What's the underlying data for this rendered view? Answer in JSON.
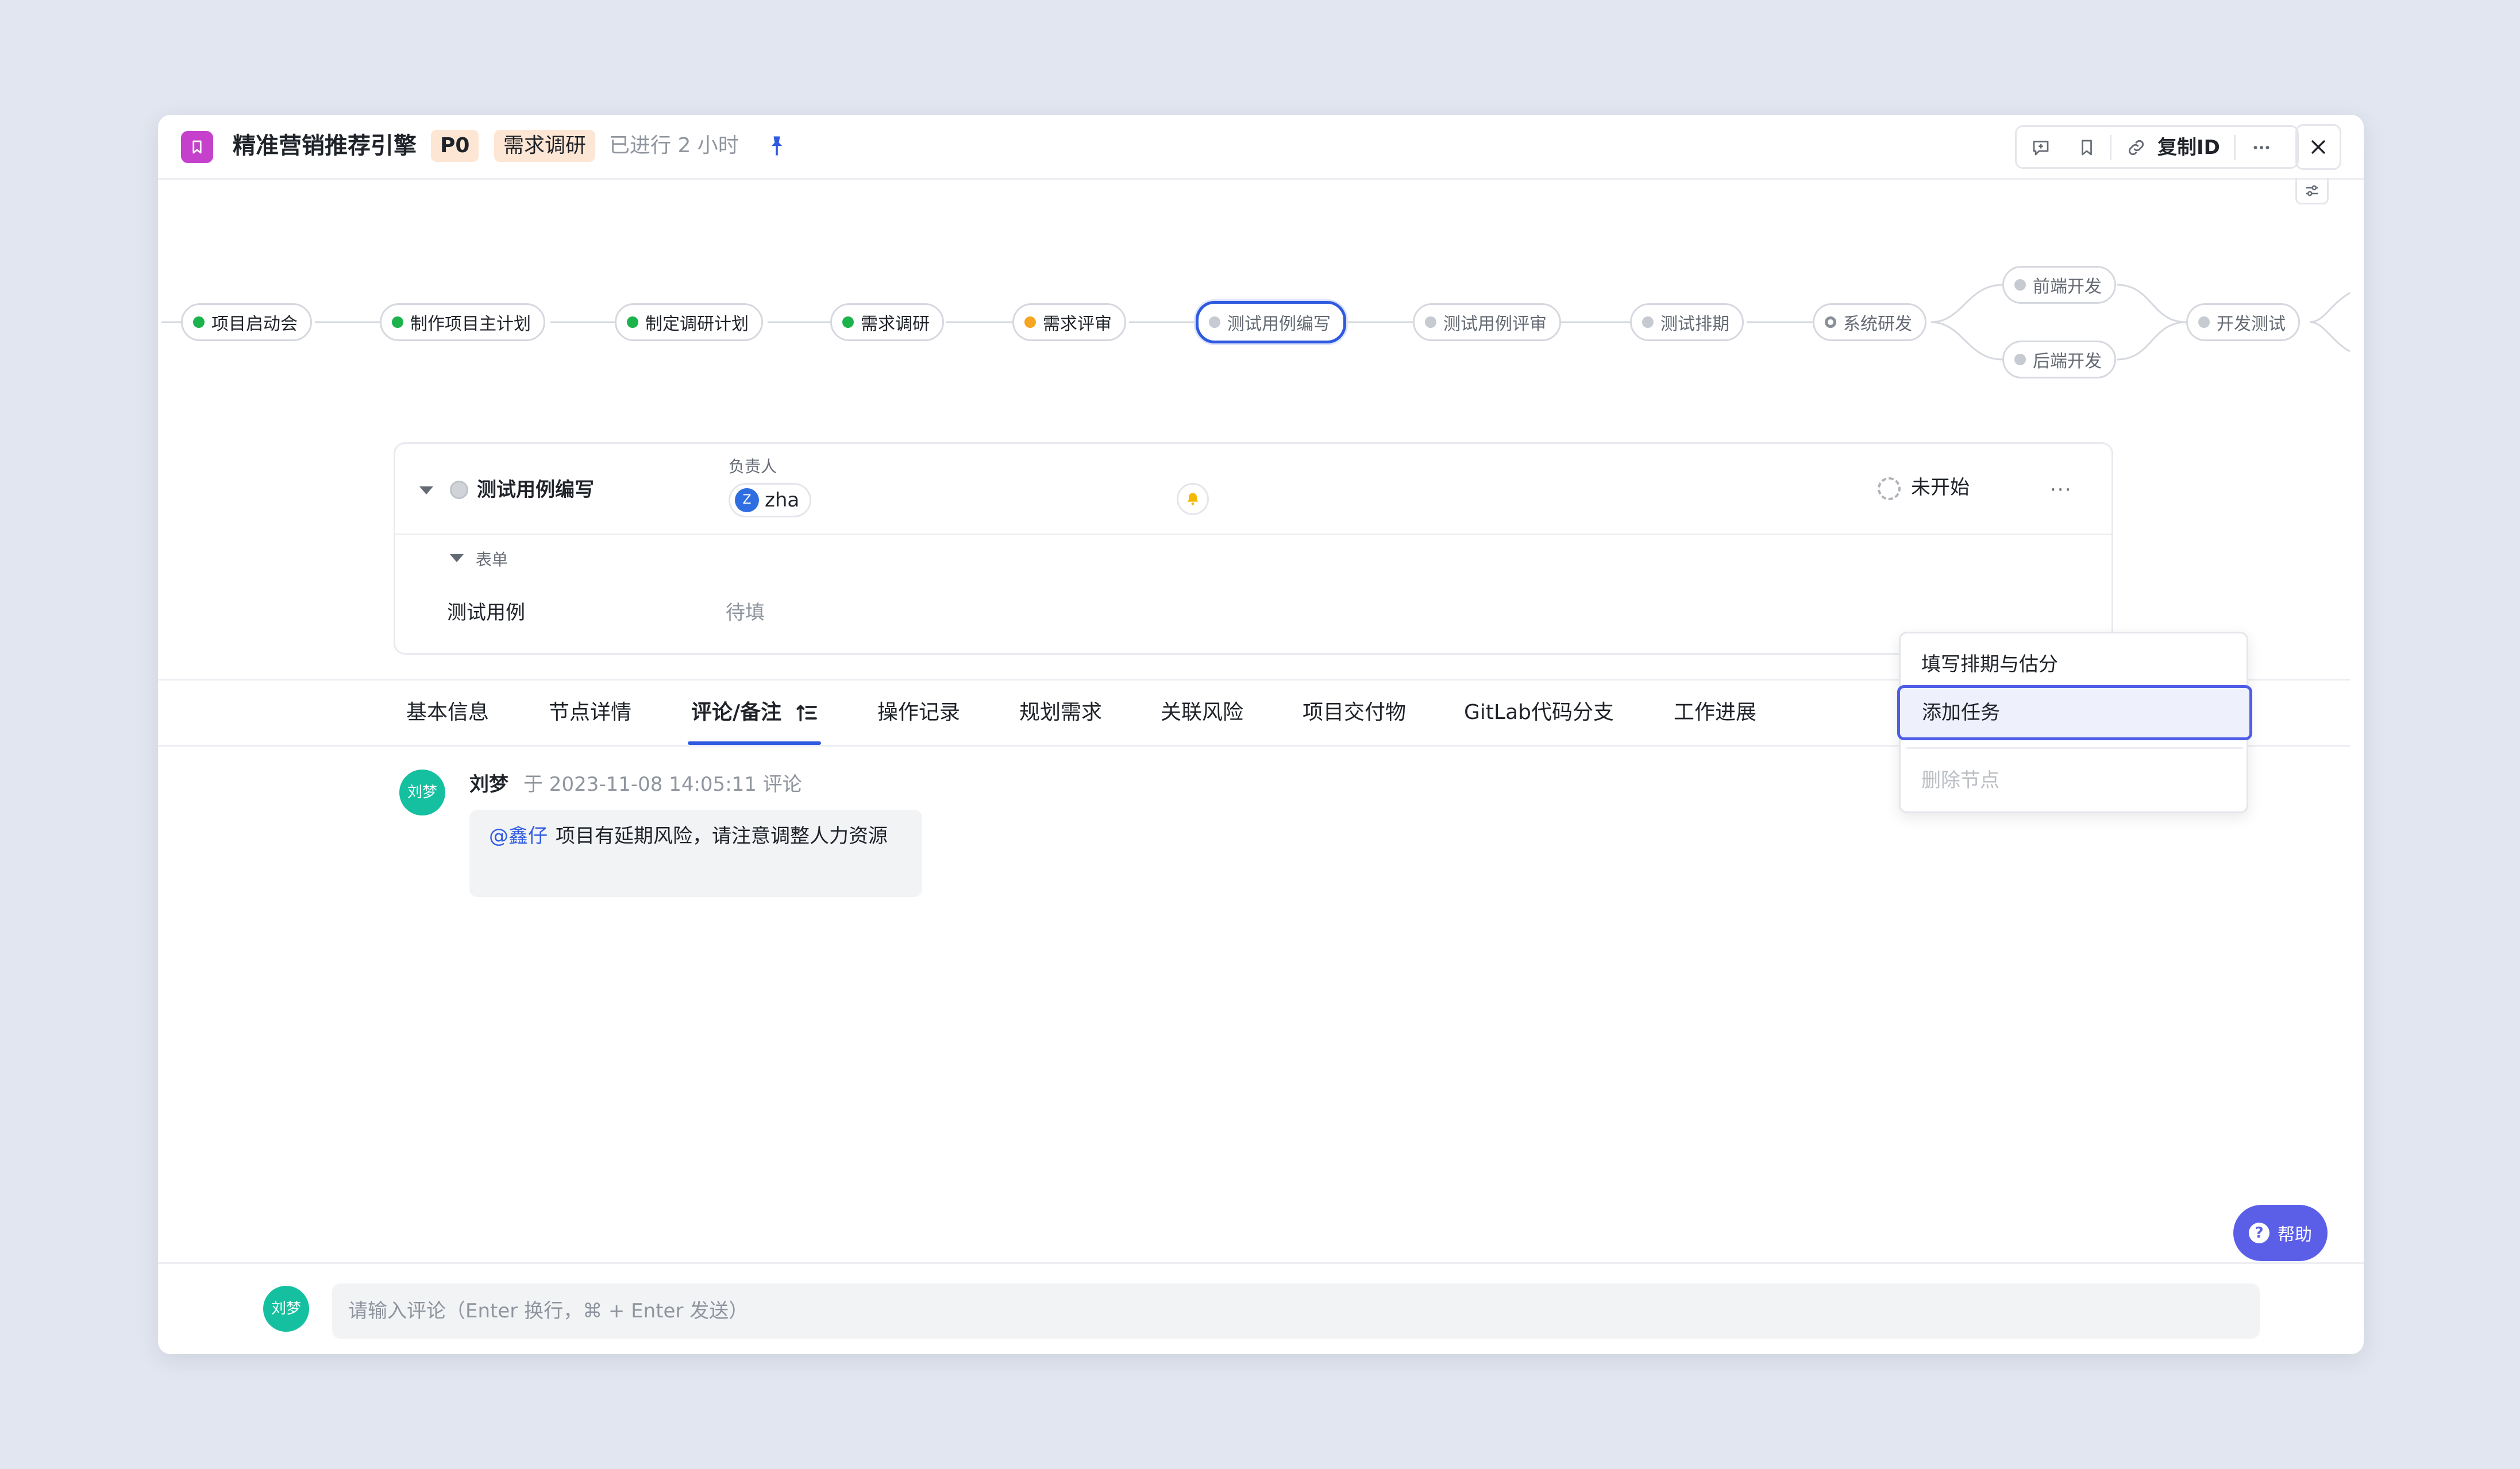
{
  "header": {
    "title": "精准营销推荐引擎",
    "priority_tag": "P0",
    "stage_tag": "需求调研",
    "elapsed": "已进行 2 小时",
    "copy_id_label": "复制ID",
    "icons": [
      "comment-add-icon",
      "bookmark-icon",
      "link-icon",
      "more-icon",
      "close-icon",
      "filter-icon",
      "pin-icon"
    ]
  },
  "pipeline": {
    "nodes": [
      {
        "label": "项目启动会",
        "status": "done"
      },
      {
        "label": "制作项目主计划",
        "status": "done"
      },
      {
        "label": "制定调研计划",
        "status": "done"
      },
      {
        "label": "需求调研",
        "status": "done"
      },
      {
        "label": "需求评审",
        "status": "review"
      },
      {
        "label": "测试用例编写",
        "status": "current"
      },
      {
        "label": "测试用例评审",
        "status": "pending"
      },
      {
        "label": "测试排期",
        "status": "pending"
      },
      {
        "label": "系统研发",
        "status": "group"
      },
      {
        "label": "前端开发",
        "status": "pending"
      },
      {
        "label": "后端开发",
        "status": "pending"
      },
      {
        "label": "开发测试",
        "status": "pending"
      }
    ],
    "colors": {
      "done": "#1db34c",
      "review": "#f5a623",
      "pending": "#c6cad1",
      "current_border": "#2f5ae0"
    }
  },
  "task": {
    "name": "测试用例编写",
    "owner_label": "负责人",
    "owner_initial": "Z",
    "owner_name": "zha",
    "status": "未开始",
    "more": "···",
    "form_label": "表单",
    "field_name": "测试用例",
    "field_value": "待填"
  },
  "menu": {
    "items": [
      "填写排期与估分",
      "添加任务",
      "删除节点"
    ],
    "highlighted": "添加任务",
    "disabled": "删除节点"
  },
  "tabs": {
    "items": [
      "基本信息",
      "节点详情",
      "评论/备注",
      "操作记录",
      "规划需求",
      "关联风险",
      "项目交付物",
      "GitLab代码分支",
      "工作进展"
    ],
    "active": "评论/备注"
  },
  "comment": {
    "avatar": "刘梦",
    "author": "刘梦",
    "meta": "于 2023-11-08 14:05:11 评论",
    "mention": "@鑫仔",
    "text": "项目有延期风险，请注意调整人力资源"
  },
  "help": {
    "label": "帮助"
  },
  "input": {
    "avatar": "刘梦",
    "placeholder": "请输入评论（Enter 换行，⌘ + Enter 发送）"
  }
}
